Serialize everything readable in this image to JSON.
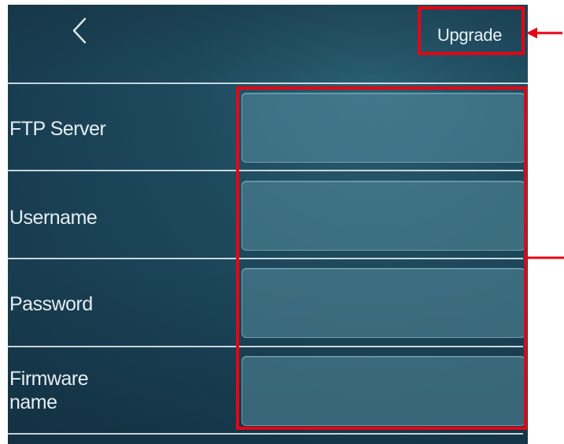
{
  "header": {
    "back_icon": "chevron-left-icon",
    "upgrade_label": "Upgrade"
  },
  "form": {
    "rows": [
      {
        "label": "FTP Server",
        "value": "",
        "placeholder": ""
      },
      {
        "label": "Username",
        "value": "",
        "placeholder": ""
      },
      {
        "label": "Password",
        "value": "",
        "placeholder": ""
      },
      {
        "label_line1": "Firmware",
        "label_line2": "name",
        "value": "",
        "placeholder": ""
      }
    ]
  },
  "annotations": {
    "highlight_color": "#e30613"
  },
  "colors": {
    "background": "#1e4a5e",
    "field_fill": "#568c9e",
    "text": "#e6eef2"
  }
}
